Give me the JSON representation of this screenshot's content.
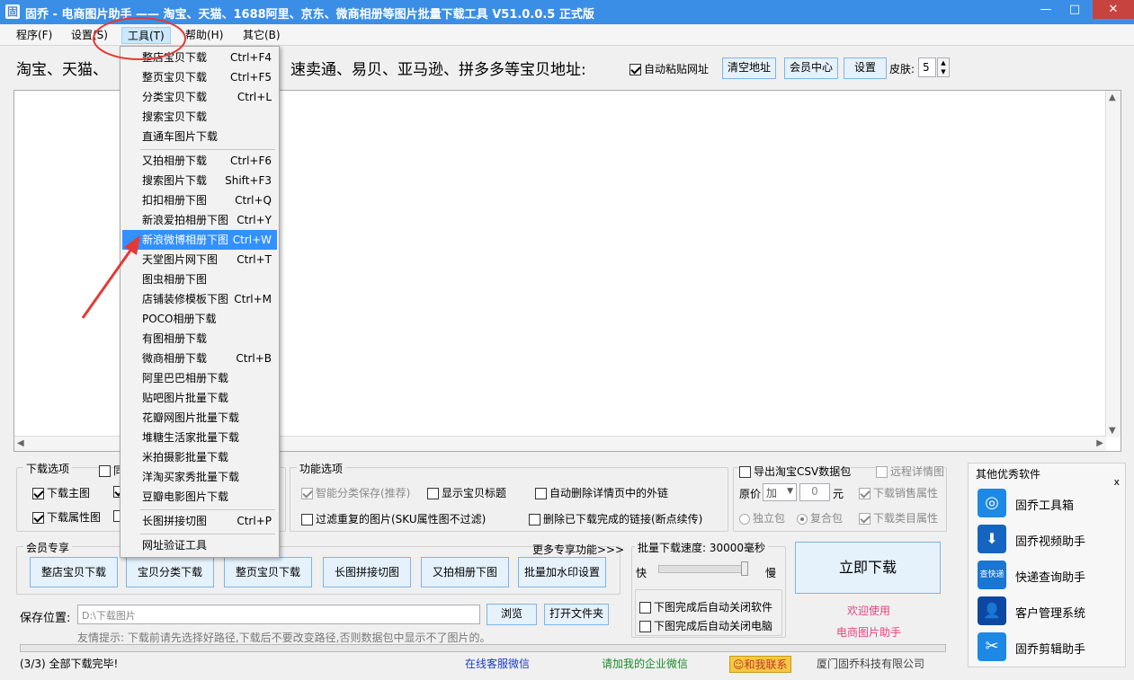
{
  "window": {
    "title": "固乔 - 电商图片助手 —— 淘宝、天猫、1688阿里、京东、微商相册等图片批量下载工具 V51.0.0.5 正式版",
    "app_icon": "固",
    "controls": {
      "minimize": "—",
      "maximize": "□",
      "close": "✕"
    }
  },
  "menu": {
    "items": [
      {
        "label": "程序(F)"
      },
      {
        "label": "设置(S)"
      },
      {
        "label": "工具(T)"
      },
      {
        "label": "帮助(H)"
      },
      {
        "label": "其它(B)"
      }
    ]
  },
  "toolbar": {
    "url_label_left": "淘宝、天猫、",
    "url_label_right": "速卖通、易贝、亚马逊、拼多多等宝贝地址:",
    "auto_paste_label": "自动粘贴网址",
    "auto_paste_checked": true,
    "clear_button": "清空地址",
    "member_button": "会员中心",
    "settings_button": "设置",
    "skin_label": "皮肤:",
    "skin_value": "5"
  },
  "dropdown": {
    "items": [
      {
        "label": "整店宝贝下载",
        "shortcut": "Ctrl+F4"
      },
      {
        "label": "整页宝贝下载",
        "shortcut": "Ctrl+F5"
      },
      {
        "label": "分类宝贝下载",
        "shortcut": "Ctrl+L"
      },
      {
        "label": "搜索宝贝下载",
        "shortcut": ""
      },
      {
        "label": "直通车图片下载",
        "shortcut": ""
      },
      {
        "label": "又拍相册下载",
        "shortcut": "Ctrl+F6"
      },
      {
        "label": "搜索图片下载",
        "shortcut": "Shift+F3"
      },
      {
        "label": "扣扣相册下图",
        "shortcut": "Ctrl+Q"
      },
      {
        "label": "新浪爱拍相册下图",
        "shortcut": "Ctrl+Y"
      },
      {
        "label": "新浪微博相册下图",
        "shortcut": "Ctrl+W"
      },
      {
        "label": "天堂图片网下图",
        "shortcut": "Ctrl+T"
      },
      {
        "label": "图虫相册下图",
        "shortcut": ""
      },
      {
        "label": "店铺装修模板下图",
        "shortcut": "Ctrl+M"
      },
      {
        "label": "POCO相册下载",
        "shortcut": ""
      },
      {
        "label": "有图相册下载",
        "shortcut": ""
      },
      {
        "label": "微商相册下载",
        "shortcut": "Ctrl+B"
      },
      {
        "label": "阿里巴巴相册下载",
        "shortcut": ""
      },
      {
        "label": "贴吧图片批量下载",
        "shortcut": ""
      },
      {
        "label": "花瓣网图片批量下载",
        "shortcut": ""
      },
      {
        "label": "堆糖生活家批量下载",
        "shortcut": ""
      },
      {
        "label": "米拍摄影批量下载",
        "shortcut": ""
      },
      {
        "label": "洋淘买家秀批量下载",
        "shortcut": ""
      },
      {
        "label": "豆瓣电影图片下载",
        "shortcut": ""
      },
      {
        "label": "长图拼接切图",
        "shortcut": "Ctrl+P"
      },
      {
        "label": "网址验证工具",
        "shortcut": ""
      }
    ]
  },
  "download_options": {
    "title": "下载选项",
    "main_image": "下载主图",
    "attr_image": "下载属性图",
    "main_checked": true,
    "attr_checked": true,
    "partial": "同"
  },
  "function_options": {
    "title": "功能选项",
    "smart_category": "智能分类保存(推荐)",
    "show_title": "显示宝贝标题",
    "auto_delete_links": "自动删除详情页中的外链",
    "filter_duplicate": "过滤重复的图片(SKU属性图不过滤)",
    "delete_completed": "删除已下载完成的链接(断点续传)"
  },
  "csv_options": {
    "export_csv": "导出淘宝CSV数据包",
    "remote_detail": "远程详情图",
    "price_label": "原价",
    "price_op": "加",
    "price_value": "0",
    "price_unit": "元",
    "sales_attr": "下载销售属性",
    "standalone": "独立包",
    "combined": "复合包",
    "category_attr": "下载类目属性"
  },
  "member": {
    "title": "会员专享",
    "more": "更多专享功能>>>",
    "buttons": [
      "整店宝贝下载",
      "宝贝分类下载",
      "整页宝贝下载",
      "长图拼接切图",
      "又拍相册下图",
      "批量加水印设置"
    ]
  },
  "speed": {
    "label": "批量下载速度: 30000毫秒",
    "fast": "快",
    "slow": "慢",
    "slider_fraction": 1.0,
    "close_software": "下图完成后自动关闭软件",
    "close_computer": "下图完成后自动关闭电脑"
  },
  "download_button": "立即下载",
  "welcome": {
    "line1": "欢迎使用",
    "line2": "电商图片助手"
  },
  "save": {
    "label": "保存位置:",
    "path": "D:\\下载图片",
    "browse": "浏览",
    "open_folder": "打开文件夹",
    "tip": "友情提示: 下载前请先选择好路径,下载后不要改变路径,否则数据包中显示不了图片的。"
  },
  "side_panel": {
    "title": "其他优秀软件",
    "close": "x",
    "items": [
      {
        "label": "固乔工具箱",
        "icon": "toolbox-icon",
        "color": "#1e88e5",
        "glyph": "◎"
      },
      {
        "label": "固乔视频助手",
        "icon": "video-download-icon",
        "color": "#1565c0",
        "glyph": "⬇"
      },
      {
        "label": "快递查询助手",
        "icon": "express-icon",
        "color": "#1976d2",
        "glyph": "查快递"
      },
      {
        "label": "客户管理系统",
        "icon": "customer-icon",
        "color": "#0d47a1",
        "glyph": "👤"
      },
      {
        "label": "固乔剪辑助手",
        "icon": "scissors-icon",
        "color": "#1e88e5",
        "glyph": "✂"
      }
    ]
  },
  "status": {
    "left": "(3/3) 全部下载完毕!",
    "service": "在线客服微信",
    "wechat": "请加我的企业微信",
    "contact": "和我联系",
    "company": "厦门固乔科技有限公司"
  },
  "colors": {
    "title_bar": "#3a8ee6",
    "highlight": "#3390ff",
    "annotation": "#e53935",
    "link_blue": "#1a3cc8",
    "link_green": "#1a8a2a",
    "pink": "#e8437a"
  }
}
